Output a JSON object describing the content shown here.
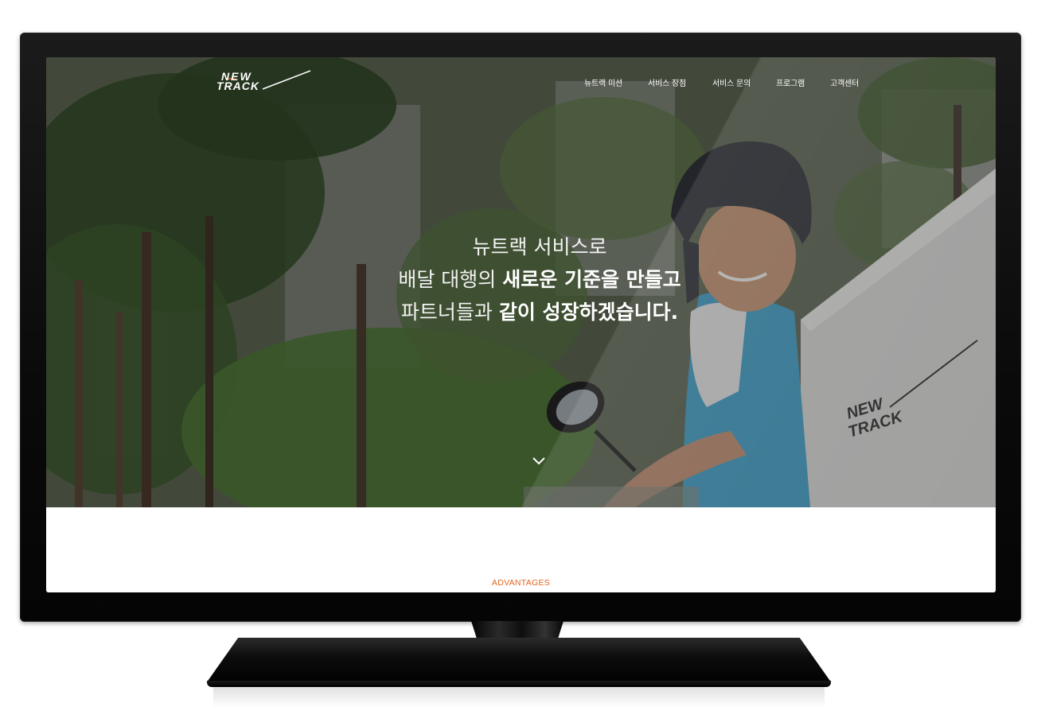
{
  "brand": {
    "logo_line1": "NEW",
    "logo_line2": "TRACK",
    "accent_color": "#e4631d"
  },
  "nav": {
    "items": [
      {
        "label": "뉴트랙 미션"
      },
      {
        "label": "서비스 장점"
      },
      {
        "label": "서비스 문의"
      },
      {
        "label": "프로그램"
      },
      {
        "label": "고객센터"
      }
    ]
  },
  "hero": {
    "line1": "뉴트랙 서비스로",
    "line2_light": "배달 대행의 ",
    "line2_bold": "새로운 기준을 만들고",
    "line3_light": "파트너들과 ",
    "line3_bold": "같이 성장하겠습니다.",
    "scroll_icon": "chevron-down-icon",
    "box_logo_line1": "NEW",
    "box_logo_line2": "TRACK"
  },
  "section": {
    "advantages_label": "ADVANTAGES"
  }
}
